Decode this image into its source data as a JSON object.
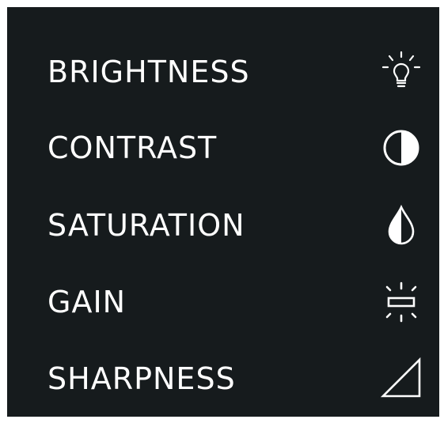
{
  "settings": {
    "items": [
      {
        "label": "BRIGHTNESS",
        "icon": "lightbulb-icon"
      },
      {
        "label": "CONTRAST",
        "icon": "contrast-icon"
      },
      {
        "label": "SATURATION",
        "icon": "saturation-drop-icon"
      },
      {
        "label": "GAIN",
        "icon": "gain-icon"
      },
      {
        "label": "SHARPNESS",
        "icon": "sharpness-icon"
      }
    ]
  },
  "colors": {
    "background": "#161b1d",
    "foreground": "#ffffff"
  }
}
